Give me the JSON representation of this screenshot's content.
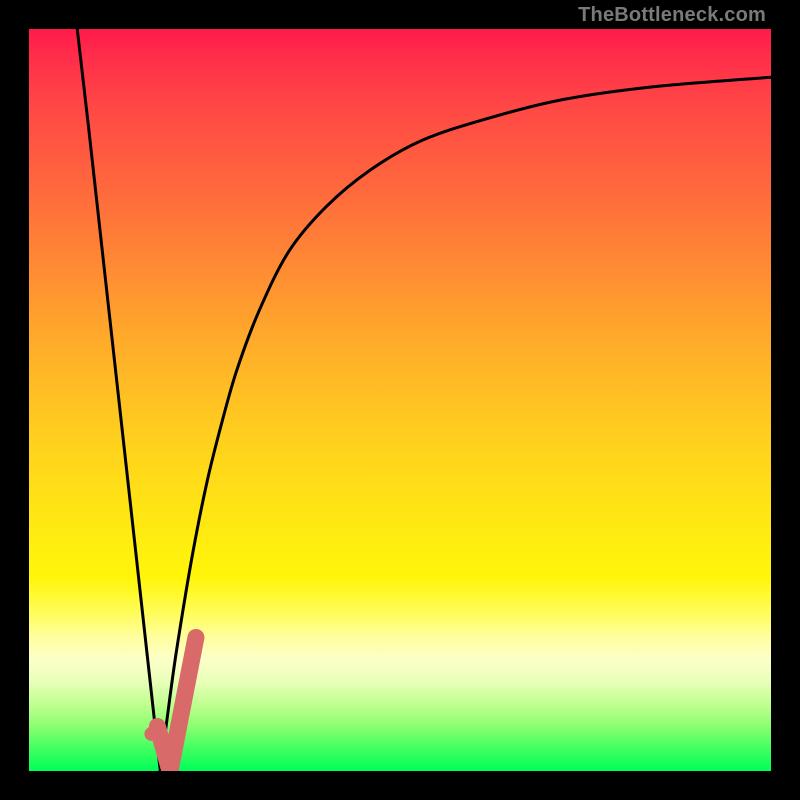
{
  "attribution": "TheBottleneck.com",
  "colors": {
    "frame": "#000000",
    "curve": "#000000",
    "annotation": "#d86a6a",
    "gradient_top": "#ff1a4a",
    "gradient_bottom": "#00ff58"
  },
  "chart_data": {
    "type": "line",
    "title": "",
    "xlabel": "",
    "ylabel": "",
    "xlim": [
      0,
      100
    ],
    "ylim": [
      0,
      100
    ],
    "grid": false,
    "legend": false,
    "series": [
      {
        "name": "left-branch",
        "x": [
          6.5,
          8,
          10,
          12,
          14,
          16,
          17,
          17.7
        ],
        "values": [
          100,
          87,
          69,
          51,
          33,
          15,
          6,
          0
        ]
      },
      {
        "name": "right-branch",
        "x": [
          17.7,
          19,
          20,
          22,
          24,
          26,
          28,
          31,
          35,
          40,
          46,
          53,
          62,
          72,
          84,
          100
        ],
        "values": [
          0,
          10,
          17,
          29,
          39,
          47,
          54,
          62,
          70,
          76,
          81,
          85,
          88,
          90.5,
          92.2,
          93.5
        ]
      }
    ],
    "annotations": [
      {
        "name": "marker-dot",
        "shape": "circle",
        "x": 16.5,
        "y": 5,
        "color": "#d86a6a"
      },
      {
        "name": "checkmark",
        "shape": "path",
        "x_start": 17.3,
        "y_start": 6,
        "x_mid": 19,
        "y_mid": 0,
        "x_end": 22.5,
        "y_end": 18,
        "color": "#d86a6a"
      }
    ],
    "background": {
      "type": "vertical-gradient",
      "description": "red at top through orange/yellow to green at bottom",
      "stops": [
        {
          "pos": 0,
          "color": "#ff1a4a"
        },
        {
          "pos": 22,
          "color": "#ff6a3c"
        },
        {
          "pos": 55,
          "color": "#ffcf1e"
        },
        {
          "pos": 74,
          "color": "#fff60a"
        },
        {
          "pos": 88,
          "color": "#e8ffb8"
        },
        {
          "pos": 100,
          "color": "#00ff58"
        }
      ]
    }
  }
}
